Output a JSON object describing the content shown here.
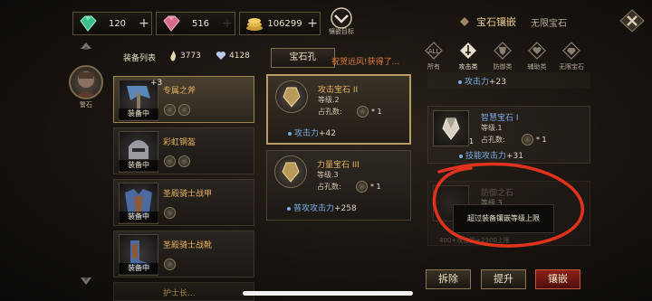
{
  "currency": [
    {
      "icon": "green-gem-icon",
      "value": "120",
      "plus": "+"
    },
    {
      "icon": "pink-gem-icon",
      "value": "516",
      "plus": "+"
    },
    {
      "icon": "gold-coins-icon",
      "value": "106299",
      "plus": "+"
    }
  ],
  "inlay_target_label": "镶嵌目标",
  "header": {
    "title": "宝石镶嵌",
    "subtitle": "无限宝石"
  },
  "hero": {
    "label": "警石"
  },
  "equip_list": {
    "title": "装备列表",
    "stat_a": "3773",
    "stat_b": "4128",
    "items": [
      {
        "name": "专属之斧",
        "badge": "装备中",
        "plus": "+3"
      },
      {
        "name": "彩虹钢盔",
        "badge": "装备中"
      },
      {
        "name": "圣殿骑士战甲",
        "badge": "装备中"
      },
      {
        "name": "圣殿骑士战靴",
        "badge": "装备中"
      }
    ],
    "next_partial": "护士长..."
  },
  "socket_panel": {
    "button": "宝石孔",
    "hint": "祝贺远风!获得了...",
    "gems": [
      {
        "name": "攻击宝石 II",
        "level": "等级.2",
        "slot": "占孔数:",
        "count": "* 1",
        "attr_name": "攻击力",
        "attr_val": "+42"
      },
      {
        "name": "力量宝石 III",
        "level": "等级.3",
        "slot": "占孔数:",
        "count": "* 1",
        "attr_name": "普攻攻击力",
        "attr_val": "+258"
      }
    ]
  },
  "filter_tabs": [
    {
      "label": "所有",
      "icon": "all-icon"
    },
    {
      "label": "攻击类",
      "icon": "sword-icon"
    },
    {
      "label": "防御类",
      "icon": "shield-icon"
    },
    {
      "label": "辅助类",
      "icon": "heart-icon"
    },
    {
      "label": "无限宝石",
      "icon": "infinity-gem-icon"
    }
  ],
  "right_list": {
    "top_attr_name": "攻击力",
    "top_attr_val": "+23",
    "gem": {
      "name": "智慧宝石 I",
      "level": "等级.1",
      "slot": "占孔数:",
      "count": "* 1",
      "stack": "1",
      "attr_name": "技能攻击力",
      "attr_val": "+31"
    },
    "faded_name": "防御之石",
    "faded_level": "等级.3",
    "faded_attr": "400+攻击力+2300上限"
  },
  "tooltip": "超过装备镶嵌等级上限",
  "actions": {
    "remove": "拆除",
    "upgrade": "提升",
    "inlay": "镶嵌"
  },
  "colors": {
    "gold_text": "#e7b45e",
    "blue_attr": "#7aaee8",
    "accent_red": "#8e2018",
    "annotation_red": "#e0321c"
  }
}
